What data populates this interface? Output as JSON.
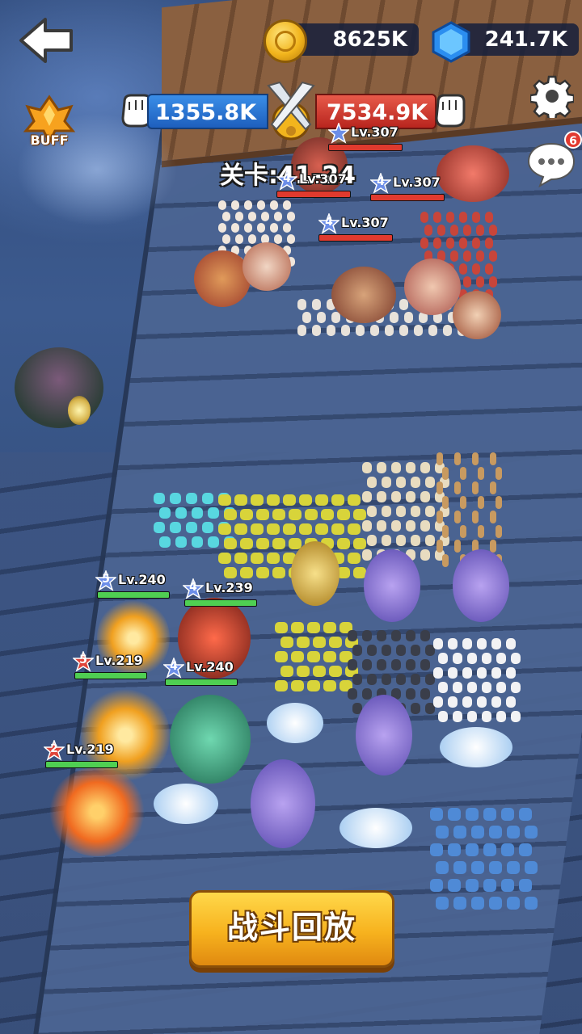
{
  "currency": {
    "gold": "8625K",
    "gems": "241.7K"
  },
  "power": {
    "player": "1355.8K",
    "enemy": "7534.9K"
  },
  "stage": {
    "label": "关卡:41-24"
  },
  "buff": {
    "label": "BUFF"
  },
  "chat": {
    "badge": "6"
  },
  "enemy_heroes": [
    {
      "star": "",
      "level": "Lv.307",
      "hp": 1.0
    },
    {
      "star": "4",
      "level": "Lv.307",
      "hp": 1.0
    },
    {
      "star": "4",
      "level": "Lv.307",
      "hp": 1.0
    },
    {
      "star": "4",
      "level": "Lv.307",
      "hp": 1.0
    }
  ],
  "player_heroes": [
    {
      "star": "5",
      "level": "Lv.240",
      "hp": 1.0
    },
    {
      "star": "4",
      "level": "Lv.239",
      "hp": 1.0
    },
    {
      "star": "5",
      "level": "Lv.219",
      "hp": 1.0
    },
    {
      "star": "4",
      "level": "Lv.240",
      "hp": 1.0
    },
    {
      "star": "2",
      "level": "Lv.219",
      "hp": 1.0
    }
  ],
  "colors": {
    "player_bar": "#4fcf52",
    "enemy_bar": "#e03a2e",
    "player_power": "#2a78d6",
    "enemy_power": "#d23a2e",
    "star_blue": "#6c8ee8",
    "star_red": "#e0443a"
  },
  "actions": {
    "replay": "战斗回放"
  }
}
